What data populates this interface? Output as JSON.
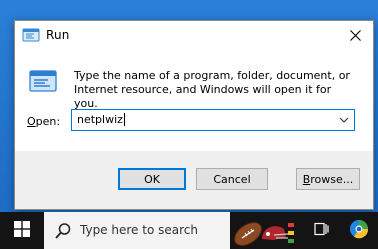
{
  "dialog": {
    "title": "Run",
    "description": "Type the name of a program, folder, document, or Internet resource, and Windows will open it for you.",
    "open_label_accel": "O",
    "open_label_rest": "pen:",
    "open_value": "netplwiz",
    "ok_label": "OK",
    "cancel_label": "Cancel",
    "browse_accel": "B",
    "browse_rest": "rowse...",
    "icons": {
      "app": "run-icon",
      "close": "close-icon",
      "dropdown": "chevron-down-icon"
    }
  },
  "taskbar": {
    "search_placeholder": "Type here to search",
    "icons": {
      "start": "windows-logo-icon",
      "search": "search-icon",
      "task_view": "task-view-icon",
      "app": "browser-app-icon"
    }
  },
  "colors": {
    "accent": "#0078d7",
    "desktop": "#1e6cc4",
    "taskbar": "#141414"
  }
}
